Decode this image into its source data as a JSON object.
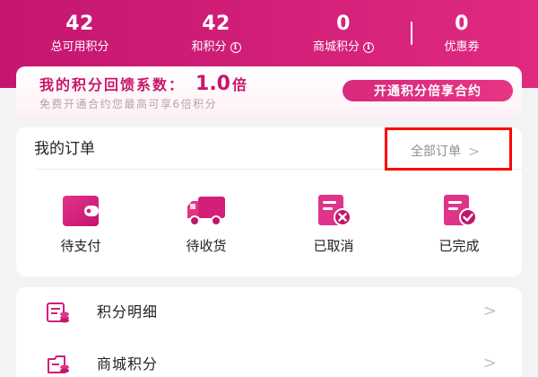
{
  "stats": [
    {
      "value": "42",
      "label": "总可用积分",
      "info": false
    },
    {
      "value": "42",
      "label": "和积分",
      "info": true
    },
    {
      "value": "0",
      "label": "商城积分",
      "info": true
    },
    {
      "value": "0",
      "label": "优惠券",
      "info": false
    }
  ],
  "rebate": {
    "label": "我的积分回馈系数：",
    "value": "1.0",
    "unit": "倍",
    "subtitle": "免费开通合约您最高可享6倍积分",
    "button": "开通积分倍享合约"
  },
  "orders": {
    "title": "我的订单",
    "all_label": "全部订单",
    "items": [
      {
        "label": "待支付",
        "icon": "wallet-icon"
      },
      {
        "label": "待收货",
        "icon": "truck-icon"
      },
      {
        "label": "已取消",
        "icon": "cancelled-order-icon"
      },
      {
        "label": "已完成",
        "icon": "completed-order-icon"
      }
    ]
  },
  "menu": [
    {
      "label": "积分明细",
      "icon": "points-detail-icon"
    },
    {
      "label": "商城积分",
      "icon": "mall-points-icon"
    }
  ],
  "colors": {
    "brand": "#d21f78",
    "highlight": "#ff0000",
    "rebate_text": "#c8166d"
  }
}
